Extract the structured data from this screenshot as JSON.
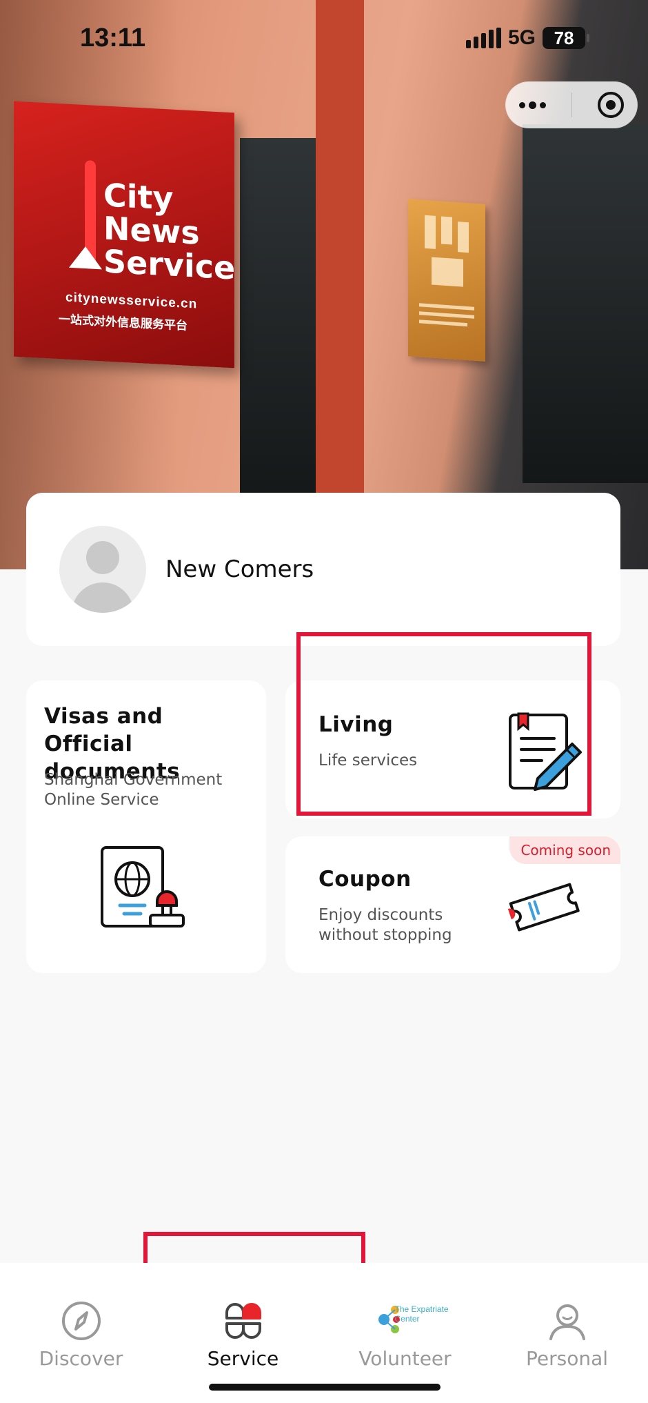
{
  "status_bar": {
    "time": "13:11",
    "network": "5G",
    "battery": "78"
  },
  "hero": {
    "sign_brand_lines": [
      "City",
      "News",
      "Service"
    ],
    "sign_url": "citynewsservice.cn",
    "sign_cn": "一站式对外信息服务平台"
  },
  "profile": {
    "name": "New Comers"
  },
  "cards": {
    "visa": {
      "title": "Visas and Official documents",
      "subtitle": "Shanghai Government Online Service"
    },
    "living": {
      "title": "Living",
      "subtitle": "Life services"
    },
    "coupon": {
      "title": "Coupon",
      "subtitle": "Enjoy discounts without stopping",
      "badge": "Coming soon"
    }
  },
  "tabs": [
    {
      "label": "Discover",
      "icon": "compass-icon"
    },
    {
      "label": "Service",
      "icon": "service-icon",
      "active": true
    },
    {
      "label": "Volunteer",
      "icon": "expatriate-center-logo",
      "logo_text": "The Expatriate Center"
    },
    {
      "label": "Personal",
      "icon": "person-icon"
    }
  ],
  "colors": {
    "accent_red": "#e3163a",
    "badge_bg": "#fde3e3",
    "badge_text": "#d1202d"
  }
}
